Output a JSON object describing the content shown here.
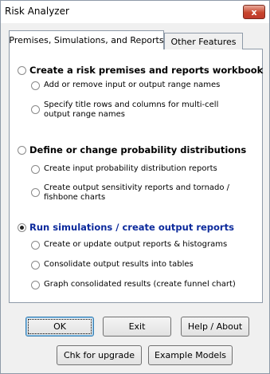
{
  "window": {
    "title": "Risk Analyzer",
    "close_glyph": "x"
  },
  "tabs": [
    {
      "label": "Premises, Simulations, and Reports",
      "active": true
    },
    {
      "label": "Other Features",
      "active": false
    }
  ],
  "sections": [
    {
      "label": "Create a risk premises and reports workbook",
      "selected": false,
      "options": [
        {
          "label": "Add or remove input or output range names"
        },
        {
          "label": "Specify title rows and columns for multi-cell output range names"
        }
      ]
    },
    {
      "label": "Define or change probability distributions",
      "selected": false,
      "options": [
        {
          "label": "Create input probability distribution reports"
        },
        {
          "label": "Create output sensitivity reports and tornado / fishbone charts"
        }
      ]
    },
    {
      "label": "Run simulations / create output reports",
      "selected": true,
      "options": [
        {
          "label": "Create or update output reports & histograms"
        },
        {
          "label": "Consolidate output results into tables"
        },
        {
          "label": "Graph consolidated results (create funnel chart)"
        }
      ]
    }
  ],
  "buttons": {
    "ok": "OK",
    "exit": "Exit",
    "help": "Help / About",
    "upgrade": "Chk for upgrade",
    "examples": "Example Models"
  },
  "colors": {
    "selected_text": "#0c2a9c",
    "close_button": "#c7452d"
  }
}
